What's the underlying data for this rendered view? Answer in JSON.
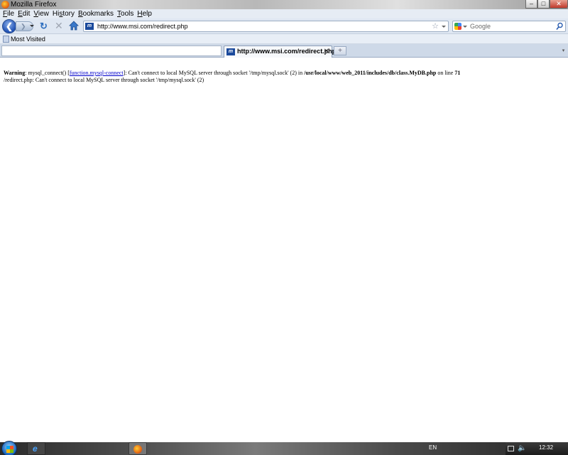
{
  "window": {
    "title": "Mozilla Firefox"
  },
  "menubar": {
    "items": [
      {
        "first": "F",
        "rest": "ile"
      },
      {
        "first": "E",
        "rest": "dit"
      },
      {
        "first": "V",
        "rest": "iew"
      },
      {
        "first": "",
        "rest": "Hi",
        "underline": "s",
        "tail": "tory"
      },
      {
        "first": "B",
        "rest": "ookmarks"
      },
      {
        "first": "T",
        "rest": "ools"
      },
      {
        "first": "H",
        "rest": "elp"
      }
    ]
  },
  "navbar": {
    "url": "http://www.msi.com/redirect.php",
    "search_placeholder": "Google"
  },
  "bookmarks": {
    "label": "Most Visited"
  },
  "tab": {
    "title": "http://www.msi.com/redirect.php",
    "site_icon_text": "m"
  },
  "page": {
    "line1": {
      "warning": "Warning",
      "text_a": ": mysql_connect() [",
      "link": "function.mysql-connect",
      "text_b": "]: Can't connect to local MySQL server through socket '/tmp/mysql.sock' (2) in ",
      "path": "/usr/local/www/web_2011/includes/db/class.MyDB.php",
      "text_c": " on line ",
      "line_no": "71"
    },
    "line2": "/redirect.php: Can't connect to local MySQL server through socket '/tmp/mysql.sock' (2)"
  },
  "taskbar": {
    "language": "EN",
    "clock": "12:32"
  },
  "colors": {
    "link": "#0000cc",
    "accent": "#1d4fb4"
  }
}
